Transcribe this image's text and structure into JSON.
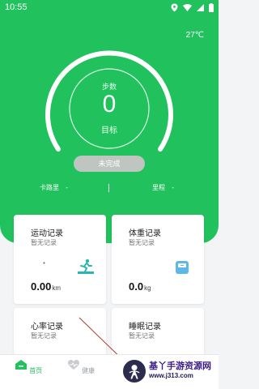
{
  "status_bar": {
    "time": "10:55"
  },
  "weather": {
    "temperature": "27℃"
  },
  "steps": {
    "title": "步数",
    "value": "0",
    "target_label": "目标",
    "status": "未完成"
  },
  "metrics": [
    {
      "label": "卡路里",
      "value": "-"
    },
    {
      "label": "里程",
      "value": "-"
    }
  ],
  "cards": {
    "exercise": {
      "title": "运动记录",
      "subtitle": "暂无记录",
      "value": "0.00",
      "unit": "km"
    },
    "weight": {
      "title": "体重记录",
      "subtitle": "暂无记录",
      "value": "0.0",
      "unit": "kg"
    },
    "heart_rate": {
      "title": "心率记录",
      "subtitle": "暂无记录"
    },
    "sleep": {
      "title": "睡眠记录",
      "subtitle": "暂无记录"
    }
  },
  "nav": [
    {
      "label": "首页",
      "icon": "home-icon",
      "active": true
    },
    {
      "label": "健康",
      "icon": "heart-rate-icon",
      "active": false
    },
    {
      "label": "",
      "icon": "profile-icon",
      "active": false
    }
  ],
  "watermark": {
    "title": "基丫手游资源网",
    "url": "www.j313.com"
  },
  "colors": {
    "primary": "#21c25d",
    "pill": "#bfc6c2",
    "background": "#f3f4f6"
  }
}
